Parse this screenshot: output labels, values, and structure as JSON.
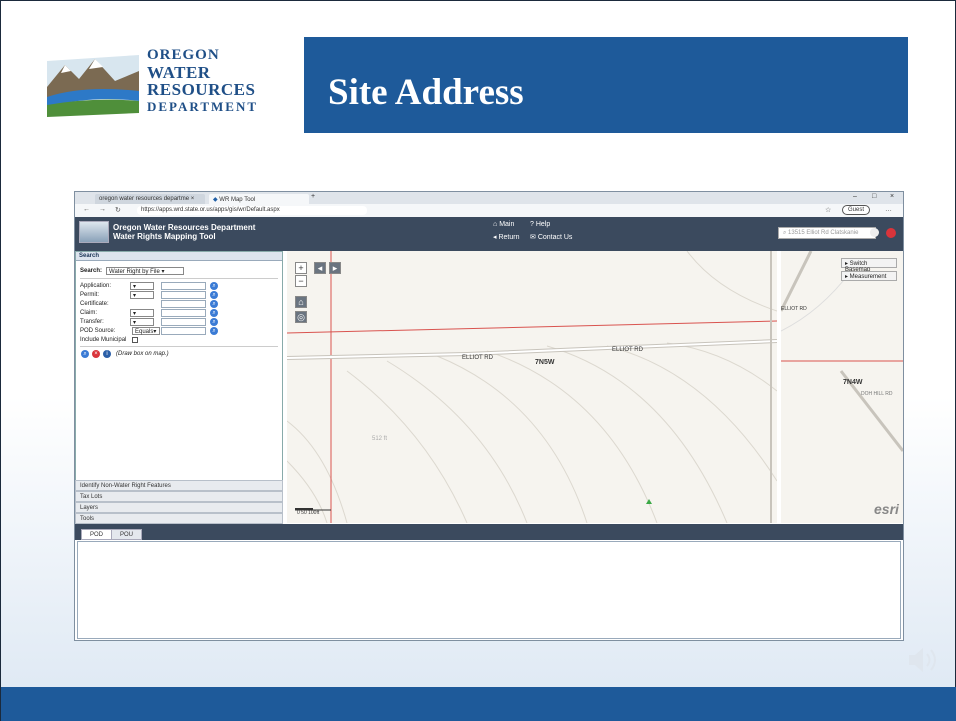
{
  "slide": {
    "title": "Site Address",
    "logo": {
      "line1": "OREGON",
      "line2": "WATER",
      "line3": "RESOURCES",
      "line4": "DEPARTMENT"
    }
  },
  "browser": {
    "tab1": "oregon water resources departme",
    "tab2": "WR Map Tool",
    "url": "https://apps.wrd.state.or.us/apps/gis/wr/Default.aspx",
    "guest": "Guest"
  },
  "app": {
    "title_line1": "Oregon Water Resources Department",
    "title_line2": "Water Rights Mapping Tool",
    "links": {
      "main": "Main",
      "help": "Help",
      "return": "Return",
      "contact": "Contact Us"
    },
    "search_placeholder": "13515 Elliot Rd Clatskanie"
  },
  "search_panel": {
    "header": "Search",
    "search_label": "Search:",
    "search_value": "Water Right by File",
    "fields": [
      "Application:",
      "Permit:",
      "Certificate:",
      "Claim:",
      "Transfer:"
    ],
    "pod_source_label": "POD Source:",
    "pod_source_value": "Equals",
    "include_municipal": "Include Municipal",
    "draw_box": "(Draw box on map.)"
  },
  "accordion": [
    "Identify Non-Water Right Features",
    "Tax Lots",
    "Layers",
    "Tools"
  ],
  "map": {
    "road1": "ELLIOT RD",
    "road2": "ELLIOT RD",
    "road3": "ELLIOT RD",
    "township": "7N5W",
    "township2": "7N4W",
    "road4": "DOH HILL RD",
    "contour": "512 ft",
    "scale": "0    50   100ft",
    "esri": "esri",
    "basemap_btn": "▸ Switch Basemap",
    "measure_btn": "▸ Measurement"
  },
  "bottom_tabs": [
    "POD",
    "POU"
  ]
}
